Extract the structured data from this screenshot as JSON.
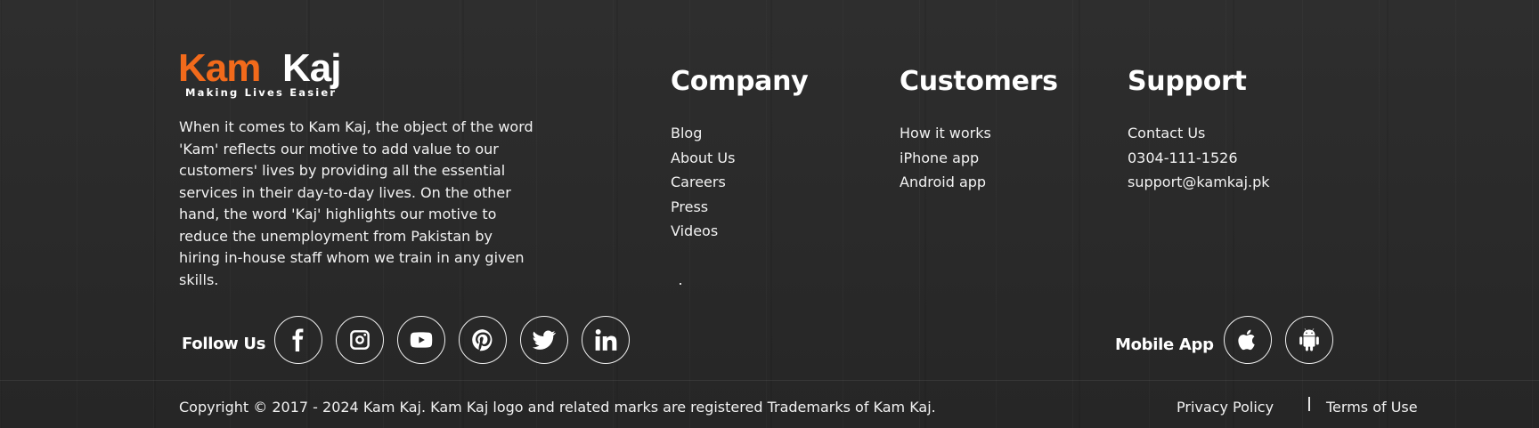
{
  "brand": {
    "logo_part1": "Kam",
    "logo_part2": "Kaj",
    "tagline": "Making Lives Easier",
    "primary_color": "#f26a1b",
    "about": "When it comes to Kam Kaj, the object of the word 'Kam' reflects our motive to add value to our customers' lives by providing all the essential services in their day-to-day lives. On the other hand, the word 'Kaj' highlights our motive to reduce the unemployment from Pakistan by hiring in-house staff whom we train in any given skills."
  },
  "columns": {
    "company": {
      "title": "Company",
      "links": [
        "Blog",
        "About Us",
        "Careers",
        "Press",
        "Videos"
      ]
    },
    "customers": {
      "title": "Customers",
      "links": [
        "How it works",
        "iPhone app",
        "Android app"
      ]
    },
    "support": {
      "title": "Support",
      "links": [
        "Contact Us",
        "0304-111-1526",
        "support@kamkaj.pk"
      ]
    }
  },
  "social": {
    "label": "Follow Us",
    "icons": [
      "facebook-icon",
      "instagram-icon",
      "youtube-icon",
      "pinterest-icon",
      "twitter-icon",
      "linkedin-icon"
    ]
  },
  "mobile_app": {
    "label": "Mobile App",
    "icons": [
      "apple-icon",
      "android-icon"
    ]
  },
  "bottom": {
    "copyright": "Copyright © 2017 - 2024 Kam Kaj. Kam Kaj logo and related marks are registered Trademarks of Kam Kaj.",
    "privacy": "Privacy Policy",
    "terms": "Terms of Use"
  }
}
